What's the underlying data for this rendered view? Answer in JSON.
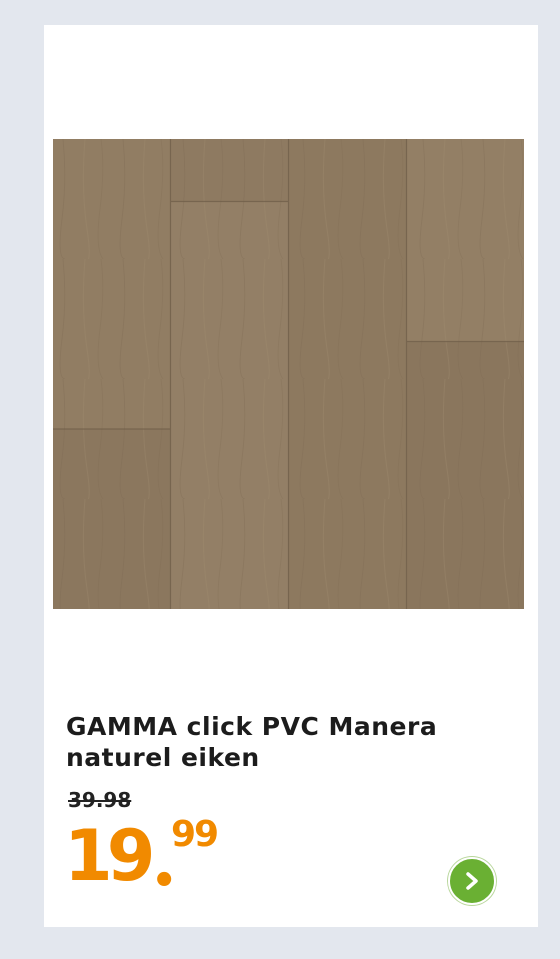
{
  "product": {
    "title_line1": "GAMMA click PVC Manera",
    "title_line2": "naturel eiken",
    "old_price": "39.98",
    "price_whole": "19",
    "price_cents": "99",
    "image_icon": "wood-floor-planks-image"
  },
  "colors": {
    "price": "#f18a00",
    "button": "#6ab033",
    "background": "#e3e7ee"
  },
  "icons": {
    "next": "chevron-right-icon"
  }
}
